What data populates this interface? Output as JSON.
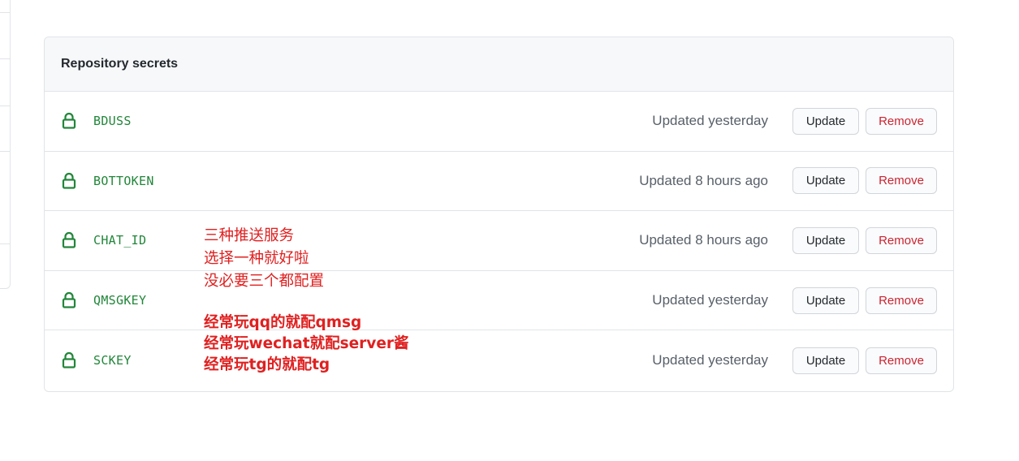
{
  "panel": {
    "title": "Repository secrets",
    "secrets": [
      {
        "name": "BDUSS",
        "updated": "Updated yesterday",
        "update_label": "Update",
        "remove_label": "Remove"
      },
      {
        "name": "BOTTOKEN",
        "updated": "Updated 8 hours ago",
        "update_label": "Update",
        "remove_label": "Remove"
      },
      {
        "name": "CHAT_ID",
        "updated": "Updated 8 hours ago",
        "update_label": "Update",
        "remove_label": "Remove"
      },
      {
        "name": "QMSGKEY",
        "updated": "Updated yesterday",
        "update_label": "Update",
        "remove_label": "Remove"
      },
      {
        "name": "SCKEY",
        "updated": "Updated yesterday",
        "update_label": "Update",
        "remove_label": "Remove"
      }
    ]
  },
  "annotation": {
    "lines_top": [
      "三种推送服务",
      "选择一种就好啦",
      "没必要三个都配置"
    ],
    "lines_bottom": [
      "经常玩qq的就配qmsg",
      "经常玩wechat就配server酱",
      "经常玩tg的就配tg"
    ]
  },
  "colors": {
    "lock": "#22863a",
    "secret_name": "#22863a",
    "remove_text": "#cb2431",
    "annotation": "#e02020"
  },
  "icons": {
    "lock": "lock-icon"
  }
}
